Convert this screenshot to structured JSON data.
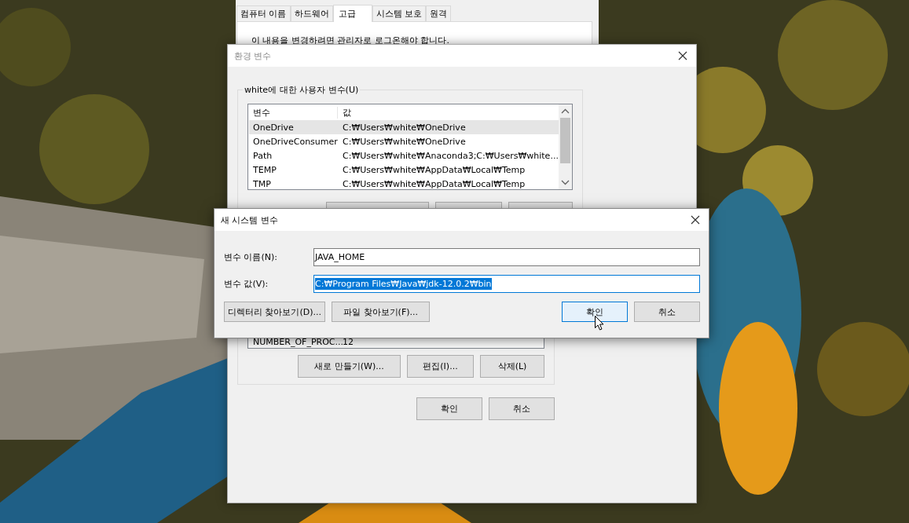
{
  "system_properties": {
    "tabs": [
      {
        "label": "컴퓨터 이름",
        "selected": false
      },
      {
        "label": "하드웨어",
        "selected": false
      },
      {
        "label": "고급",
        "selected": true
      },
      {
        "label": "시스템 보호",
        "selected": false
      },
      {
        "label": "원격",
        "selected": false
      }
    ],
    "notice": "이 내용을 변경하려면 관리자로 로그온해야 합니다."
  },
  "environment_variables": {
    "title": "환경 변수",
    "user_variables": {
      "label": "white에 대한 사용자 변수(U)",
      "columns": [
        "변수",
        "값"
      ],
      "rows": [
        {
          "name": "OneDrive",
          "value": "C:₩Users₩white₩OneDrive",
          "selected": true
        },
        {
          "name": "OneDriveConsumer",
          "value": "C:₩Users₩white₩OneDrive",
          "selected": false
        },
        {
          "name": "Path",
          "value": "C:₩Users₩white₩Anaconda3;C:₩Users₩white...",
          "selected": false
        },
        {
          "name": "TEMP",
          "value": "C:₩Users₩white₩AppData₩Local₩Temp",
          "selected": false
        },
        {
          "name": "TMP",
          "value": "C:₩Users₩white₩AppData₩Local₩Temp",
          "selected": false
        }
      ]
    },
    "system_variables": {
      "rows": [
        {
          "name": "NUMBER_OF_PROC...",
          "value": "12"
        }
      ],
      "buttons": [
        "새로 만들기(W)...",
        "편집(I)...",
        "삭제(L)"
      ]
    },
    "buttons": [
      "확인",
      "취소"
    ]
  },
  "new_system_variable": {
    "title": "새 시스템 변수",
    "fields": [
      {
        "label": "변수 이름(N):",
        "value": "JAVA_HOME",
        "value_selected": false
      },
      {
        "label": "변수 값(V):",
        "value": "C:₩Program Files₩Java₩jdk-12.0.2₩bin",
        "value_selected": true
      }
    ],
    "browse_buttons": [
      "디렉터리 찾아보기(D)...",
      "파일 찾아보기(F)..."
    ],
    "buttons": [
      {
        "label": "확인",
        "default": true
      },
      {
        "label": "취소",
        "default": false
      }
    ]
  }
}
